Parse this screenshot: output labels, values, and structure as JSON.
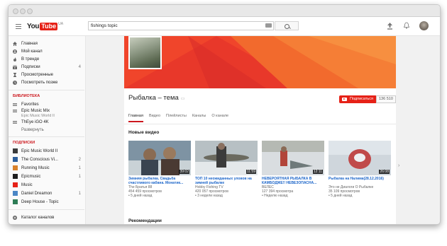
{
  "masthead": {
    "logo_you": "You",
    "logo_tube": "Tube",
    "logo_region": "UA",
    "search_value": "fishings topic"
  },
  "sidebar": {
    "nav": [
      {
        "label": "Главная",
        "icon": "home-icon"
      },
      {
        "label": "Мой канал",
        "icon": "user-icon"
      },
      {
        "label": "В тренде",
        "icon": "flame-icon"
      },
      {
        "label": "Подписки",
        "icon": "subscriptions-icon",
        "count": "4"
      },
      {
        "label": "Просмотренные",
        "icon": "hourglass-icon"
      },
      {
        "label": "Посмотреть позже",
        "icon": "clock-icon"
      }
    ],
    "library_heading": "БИБЛИОТЕКА",
    "library": [
      {
        "label": "Favorites"
      },
      {
        "label": "Epic Music Mix",
        "sub": "Epic Music World II"
      },
      {
        "label": "ThEye iGO 4K"
      }
    ],
    "expand_label": "Развернуть",
    "subs_heading": "ПОДПИСКИ",
    "subscriptions": [
      {
        "label": "Epic Music World II",
        "color": "#3a3a3a"
      },
      {
        "label": "The Conscious Vi...",
        "count": "2",
        "color": "#2d5f9c"
      },
      {
        "label": "Running Music",
        "count": "1",
        "color": "#d9822b"
      },
      {
        "label": "Epicmusic",
        "count": "1",
        "color": "#1e1e1e"
      },
      {
        "label": "Music",
        "color": "#e62117"
      },
      {
        "label": "Daniel Dreamon",
        "count": "1",
        "color": "#4a86c5"
      },
      {
        "label": "Deep House - Topic",
        "color": "#2e7d56"
      }
    ],
    "catalog_label": "Каталог каналов"
  },
  "channel": {
    "title": "Рыбалка – тема",
    "subscribe_label": "Подписаться",
    "subscriber_count": "136 510",
    "tabs": [
      "Главная",
      "Видео",
      "Плейлисты",
      "Каналы",
      "О канале"
    ]
  },
  "sections": {
    "new_videos": "Новые видео",
    "recommendations": "Рекомендации"
  },
  "videos": [
    {
      "title": "Зимняя рыбалка. Свадьба счастливого кабана. Монатик...",
      "channel": "The Братья 88",
      "views": "454 459 просмотров",
      "time": "• 5 дней назад",
      "duration": "39:02"
    },
    {
      "title": "ТОП 10 неожиданных уловов на зимней рыбалке",
      "channel": "Hobby Fishing TV",
      "views": "420 057 просмотров",
      "time": "• 3 недели назад",
      "duration": "11:59"
    },
    {
      "title": "НЕВЕРОЯТНАЯ РЫБАЛКА В КАМБОДЖЕ!! НЕВЕЗОПАСНА...",
      "channel": "ВЕЛЕС",
      "views": "127 394 просмотра",
      "time": "• Неделю назад",
      "duration": "12:11"
    },
    {
      "title": "Рыбалка на Налима(28.12.2016)",
      "channel": "Это не Диалоги О Рыбалке",
      "views": "35 109 просмотров",
      "time": "• 5 дней назад",
      "duration": "26:08"
    }
  ],
  "colors": {
    "brand_red": "#e62117",
    "link_blue": "#1b65c9",
    "banner_orange": "#f25a2b"
  }
}
